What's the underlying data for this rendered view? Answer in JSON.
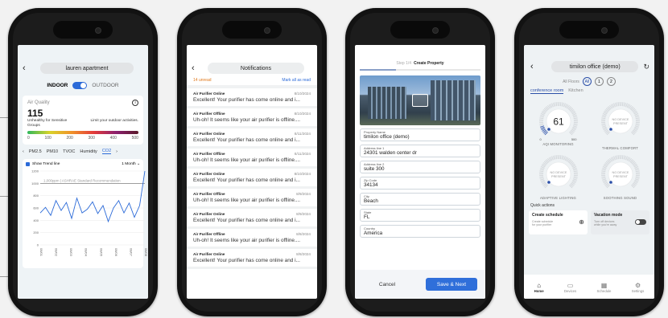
{
  "screen1": {
    "title": "lauren apartment",
    "indoor_label": "INDOOR",
    "outdoor_label": "OUTDOOR",
    "aq_heading": "Air Quality",
    "aq_value": "115",
    "aq_status": "Unhealthy for Sensitive Groups",
    "aq_advice": "Limit your outdoor activities.",
    "scale": [
      "0",
      "100",
      "200",
      "300",
      "400",
      "500"
    ],
    "pollutant_tabs": [
      "PM2.5",
      "PM10",
      "TVOC",
      "Humidity",
      "CO2"
    ],
    "trend_label": "Show Trend line",
    "period": "1 Month",
    "threshold_label": "1,000ppm | ASHRAE Standard Recommendation",
    "chart_data": {
      "type": "line",
      "title": "",
      "xlabel": "",
      "ylabel": "",
      "ylim": [
        0,
        1200
      ],
      "y_ticks": [
        "1200",
        "1000",
        "800",
        "600",
        "400",
        "200",
        "0"
      ],
      "x": [
        "08/01",
        "08/02",
        "08/03",
        "08/04",
        "08/05",
        "08/06",
        "08/07",
        "08/08"
      ],
      "series": [
        {
          "values": [
            520,
            610,
            480,
            720,
            560,
            690,
            430,
            760,
            520,
            580,
            700,
            510,
            640,
            380,
            600,
            720,
            520,
            680,
            450,
            640,
            1200
          ]
        }
      ],
      "threshold": 1000,
      "grid": true
    }
  },
  "screen2": {
    "title": "Notifications",
    "unread": "14 unread",
    "mark_all": "Mark all as read",
    "items": [
      {
        "title": "Air Purifier Online",
        "date": "8/10/2024",
        "body": "Excellent! Your purifier has come online and i..."
      },
      {
        "title": "Air Purifier Offline",
        "date": "8/10/2024",
        "body": "Uh-oh! It seems like your air purifier is offline...."
      },
      {
        "title": "Air Purifier Online",
        "date": "8/11/2024",
        "body": "Excellent! Your purifier has come online and i..."
      },
      {
        "title": "Air Purifier Offline",
        "date": "8/11/2024",
        "body": "Uh-oh! It seems like your air purifier is offline...."
      },
      {
        "title": "Air Purifier Online",
        "date": "8/10/2024",
        "body": "Excellent! Your purifier has come online and i..."
      },
      {
        "title": "Air Purifier Offline",
        "date": "8/9/2024",
        "body": "Uh-oh! It seems like your air purifier is offline...."
      },
      {
        "title": "Air Purifier Online",
        "date": "8/9/2024",
        "body": "Excellent! Your purifier has come online and i..."
      },
      {
        "title": "Air Purifier Offline",
        "date": "8/8/2024",
        "body": "Uh-oh! It seems like your air purifier is offline...."
      },
      {
        "title": "Air Purifier Online",
        "date": "8/8/2024",
        "body": "Excellent! Your purifier has come online and i..."
      }
    ]
  },
  "screen3": {
    "step_muted": "Step 1/4",
    "step_title": "Create Property",
    "fields": [
      {
        "label": "Property Name",
        "value": "timilon office (demo)"
      },
      {
        "label": "Address line 1",
        "value": "24301 walden center dr"
      },
      {
        "label": "Address line 2",
        "value": "suite 300"
      },
      {
        "label": "Zip Code",
        "value": "34134"
      },
      {
        "label": "City",
        "value": "Beach"
      },
      {
        "label": "State",
        "value": "FL"
      },
      {
        "label": "Country",
        "value": "America"
      }
    ],
    "cancel": "Cancel",
    "save": "Save & Next"
  },
  "screen4": {
    "title": "timilon office (demo)",
    "all_floors": "All Floors",
    "floor_chips": [
      "All",
      "1",
      "2"
    ],
    "rooms": [
      "conference room",
      "Kitchen"
    ],
    "aqi_value": "61",
    "aqi_min": "0",
    "aqi_max": "500",
    "no_device": "NO DEVICE PRESENT",
    "dials": [
      "AQI MONITORING",
      "THERMAL COMFORT",
      "ADAPTIVE LIGHTING",
      "SOOTHING SOUND"
    ],
    "quick_actions": "Quick actions",
    "qa_cards": [
      {
        "title": "Create schedule",
        "desc": "Create schedule for your purifier"
      },
      {
        "title": "Vacation mode",
        "desc": "Turn off devices while you're away"
      }
    ],
    "nav": [
      "Home",
      "Devices",
      "Schedule",
      "Settings"
    ]
  }
}
